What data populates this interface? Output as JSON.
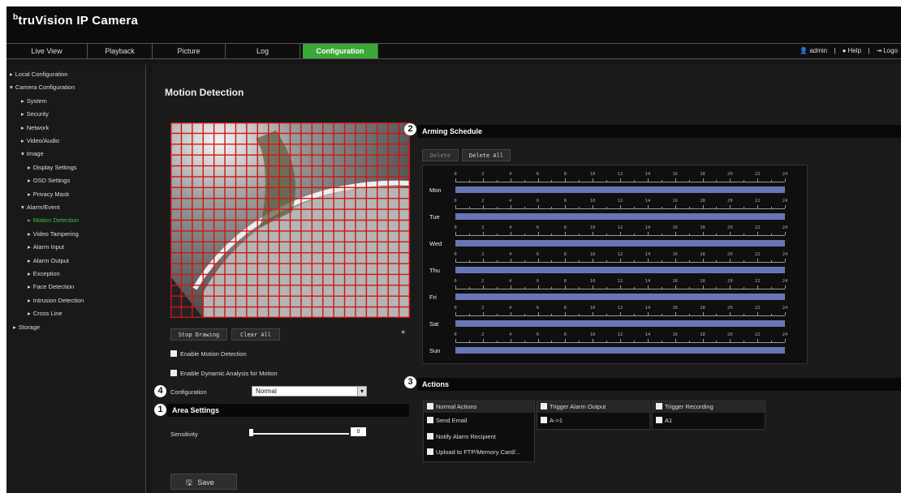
{
  "brand": {
    "icon": "b",
    "name": "truVision IP Camera"
  },
  "nav": {
    "tabs": [
      "Live View",
      "Playback",
      "Picture",
      "Log",
      "Configuration"
    ],
    "active": "Configuration",
    "user": "admin",
    "help": "Help",
    "logout": "Logo"
  },
  "sidebar": [
    {
      "label": "Local Configuration",
      "arrow": "▸"
    },
    {
      "label": "Camera Configuration",
      "arrow": "▾"
    },
    {
      "label": "System",
      "arrow": "▸"
    },
    {
      "label": "Security",
      "arrow": "▸"
    },
    {
      "label": "Network",
      "arrow": "▸"
    },
    {
      "label": "Video/Audio",
      "arrow": "▸"
    },
    {
      "label": "Image",
      "arrow": "▾"
    },
    {
      "label": "Display Settings",
      "arrow": "▸"
    },
    {
      "label": "OSD Settings",
      "arrow": "▸"
    },
    {
      "label": "Privacy Mask",
      "arrow": "▸"
    },
    {
      "label": "Alarm/Event",
      "arrow": "▾"
    },
    {
      "label": "Motion Detection",
      "arrow": "▸",
      "active": true
    },
    {
      "label": "Video Tampering",
      "arrow": "▸"
    },
    {
      "label": "Alarm Input",
      "arrow": "▸"
    },
    {
      "label": "Alarm Output",
      "arrow": "▸"
    },
    {
      "label": "Exception",
      "arrow": "▸"
    },
    {
      "label": "Face Detection",
      "arrow": "▸"
    },
    {
      "label": "Intrusion Detection",
      "arrow": "▸"
    },
    {
      "label": "Cross Line",
      "arrow": "▸"
    },
    {
      "label": "Storage",
      "arrow": "▸"
    }
  ],
  "main": {
    "title": "Motion Detection",
    "stop_drawing": "Stop Drawing",
    "clear_all": "Clear All",
    "enable_motion": "Enable Motion Detection",
    "enable_dynamic": "Enable Dynamic Analysis for Motion",
    "configuration_label": "Configuration",
    "configuration_value": "Normal",
    "area_settings": "Area Settings",
    "sensitivity_label": "Sensitivity",
    "sensitivity_value": "0",
    "save": "Save",
    "arming_schedule": "Arming Schedule",
    "delete": "Delete",
    "delete_all": "Delete All",
    "days": [
      "Mon",
      "Tue",
      "Wed",
      "Thu",
      "Fri",
      "Sat",
      "Sun"
    ],
    "hours": [
      "0",
      "2",
      "4",
      "6",
      "8",
      "10",
      "12",
      "14",
      "16",
      "18",
      "20",
      "22",
      "24"
    ],
    "actions_title": "Actions",
    "actions": {
      "normal_header": "Normal Actions",
      "send_email": "Send Email",
      "notify": "Notify Alarm Recipient",
      "upload": "Upload to FTP/Memory Card/...",
      "alarm_header": "Trigger Alarm Output",
      "alarm_item": "A->1",
      "rec_header": "Trigger Recording",
      "rec_item": "A1"
    },
    "badges": [
      "1",
      "2",
      "3",
      "4"
    ],
    "accent": "#3aa836",
    "schedule_bar_color": "#6a75b8",
    "grid_color": "#d01515"
  }
}
